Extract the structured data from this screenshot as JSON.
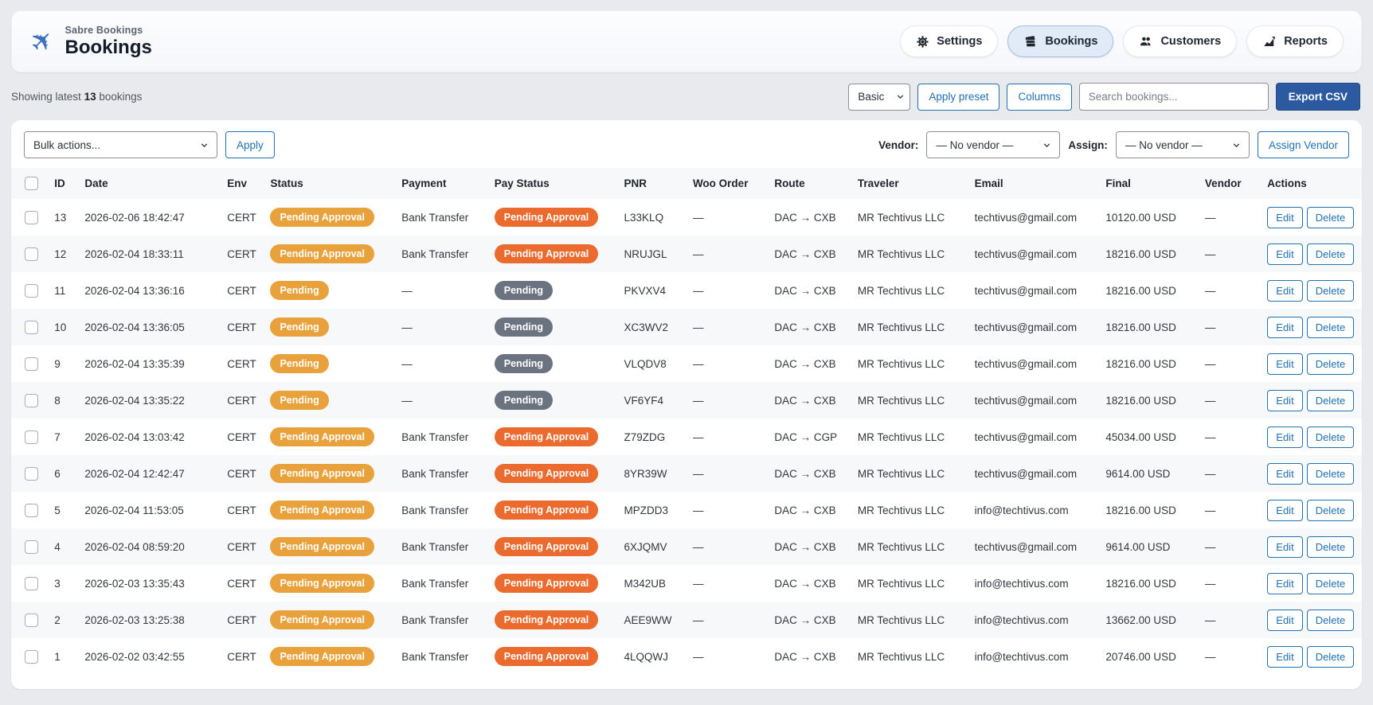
{
  "header": {
    "brand": "Sabre Bookings",
    "title": "Bookings",
    "nav": [
      {
        "label": "Settings",
        "icon": "gear-icon",
        "active": false
      },
      {
        "label": "Bookings",
        "icon": "tickets-icon",
        "active": true
      },
      {
        "label": "Customers",
        "icon": "people-icon",
        "active": false
      },
      {
        "label": "Reports",
        "icon": "chart-icon",
        "active": false
      }
    ]
  },
  "toolbar": {
    "showing_prefix": "Showing latest ",
    "showing_count": "13",
    "showing_suffix": " bookings",
    "preset_select_value": "Basic",
    "apply_preset_label": "Apply preset",
    "columns_label": "Columns",
    "search_placeholder": "Search bookings...",
    "export_label": "Export CSV"
  },
  "bulkbar": {
    "bulk_select_value": "Bulk actions...",
    "apply_label": "Apply",
    "vendor_label": "Vendor:",
    "vendor_select_value": "— No vendor —",
    "assign_label": "Assign:",
    "assign_select_value": "— No vendor —",
    "assign_vendor_label": "Assign Vendor"
  },
  "table": {
    "columns": [
      "ID",
      "Date",
      "Env",
      "Status",
      "Payment",
      "Pay Status",
      "PNR",
      "Woo Order",
      "Route",
      "Traveler",
      "Email",
      "Final",
      "Vendor",
      "Actions"
    ],
    "edit_label": "Edit",
    "delete_label": "Delete",
    "rows": [
      {
        "id": "13",
        "date": "2026-02-06 18:42:47",
        "env": "CERT",
        "status": "Pending Approval",
        "status_type": "amber",
        "payment": "Bank Transfer",
        "pay_status": "Pending Approval",
        "pay_type": "orange",
        "pnr": "L33KLQ",
        "woo_order": "—",
        "route": "DAC → CXB",
        "traveler": "MR Techtivus LLC",
        "email": "techtivus@gmail.com",
        "final": "10120.00 USD",
        "vendor": "—"
      },
      {
        "id": "12",
        "date": "2026-02-04 18:33:11",
        "env": "CERT",
        "status": "Pending Approval",
        "status_type": "amber",
        "payment": "Bank Transfer",
        "pay_status": "Pending Approval",
        "pay_type": "orange",
        "pnr": "NRUJGL",
        "woo_order": "—",
        "route": "DAC → CXB",
        "traveler": "MR Techtivus LLC",
        "email": "techtivus@gmail.com",
        "final": "18216.00 USD",
        "vendor": "—"
      },
      {
        "id": "11",
        "date": "2026-02-04 13:36:16",
        "env": "CERT",
        "status": "Pending",
        "status_type": "amber",
        "payment": "—",
        "pay_status": "Pending",
        "pay_type": "gray",
        "pnr": "PKVXV4",
        "woo_order": "—",
        "route": "DAC → CXB",
        "traveler": "MR Techtivus LLC",
        "email": "techtivus@gmail.com",
        "final": "18216.00 USD",
        "vendor": "—"
      },
      {
        "id": "10",
        "date": "2026-02-04 13:36:05",
        "env": "CERT",
        "status": "Pending",
        "status_type": "amber",
        "payment": "—",
        "pay_status": "Pending",
        "pay_type": "gray",
        "pnr": "XC3WV2",
        "woo_order": "—",
        "route": "DAC → CXB",
        "traveler": "MR Techtivus LLC",
        "email": "techtivus@gmail.com",
        "final": "18216.00 USD",
        "vendor": "—"
      },
      {
        "id": "9",
        "date": "2026-02-04 13:35:39",
        "env": "CERT",
        "status": "Pending",
        "status_type": "amber",
        "payment": "—",
        "pay_status": "Pending",
        "pay_type": "gray",
        "pnr": "VLQDV8",
        "woo_order": "—",
        "route": "DAC → CXB",
        "traveler": "MR Techtivus LLC",
        "email": "techtivus@gmail.com",
        "final": "18216.00 USD",
        "vendor": "—"
      },
      {
        "id": "8",
        "date": "2026-02-04 13:35:22",
        "env": "CERT",
        "status": "Pending",
        "status_type": "amber",
        "payment": "—",
        "pay_status": "Pending",
        "pay_type": "gray",
        "pnr": "VF6YF4",
        "woo_order": "—",
        "route": "DAC → CXB",
        "traveler": "MR Techtivus LLC",
        "email": "techtivus@gmail.com",
        "final": "18216.00 USD",
        "vendor": "—"
      },
      {
        "id": "7",
        "date": "2026-02-04 13:03:42",
        "env": "CERT",
        "status": "Pending Approval",
        "status_type": "amber",
        "payment": "Bank Transfer",
        "pay_status": "Pending Approval",
        "pay_type": "orange",
        "pnr": "Z79ZDG",
        "woo_order": "—",
        "route": "DAC → CGP",
        "traveler": "MR Techtivus LLC",
        "email": "techtivus@gmail.com",
        "final": "45034.00 USD",
        "vendor": "—"
      },
      {
        "id": "6",
        "date": "2026-02-04 12:42:47",
        "env": "CERT",
        "status": "Pending Approval",
        "status_type": "amber",
        "payment": "Bank Transfer",
        "pay_status": "Pending Approval",
        "pay_type": "orange",
        "pnr": "8YR39W",
        "woo_order": "—",
        "route": "DAC → CXB",
        "traveler": "MR Techtivus LLC",
        "email": "techtivus@gmail.com",
        "final": "9614.00 USD",
        "vendor": "—"
      },
      {
        "id": "5",
        "date": "2026-02-04 11:53:05",
        "env": "CERT",
        "status": "Pending Approval",
        "status_type": "amber",
        "payment": "Bank Transfer",
        "pay_status": "Pending Approval",
        "pay_type": "orange",
        "pnr": "MPZDD3",
        "woo_order": "—",
        "route": "DAC → CXB",
        "traveler": "MR Techtivus LLC",
        "email": "info@techtivus.com",
        "final": "18216.00 USD",
        "vendor": "—"
      },
      {
        "id": "4",
        "date": "2026-02-04 08:59:20",
        "env": "CERT",
        "status": "Pending Approval",
        "status_type": "amber",
        "payment": "Bank Transfer",
        "pay_status": "Pending Approval",
        "pay_type": "orange",
        "pnr": "6XJQMV",
        "woo_order": "—",
        "route": "DAC → CXB",
        "traveler": "MR Techtivus LLC",
        "email": "techtivus@gmail.com",
        "final": "9614.00 USD",
        "vendor": "—"
      },
      {
        "id": "3",
        "date": "2026-02-03 13:35:43",
        "env": "CERT",
        "status": "Pending Approval",
        "status_type": "amber",
        "payment": "Bank Transfer",
        "pay_status": "Pending Approval",
        "pay_type": "orange",
        "pnr": "M342UB",
        "woo_order": "—",
        "route": "DAC → CXB",
        "traveler": "MR Techtivus LLC",
        "email": "info@techtivus.com",
        "final": "18216.00 USD",
        "vendor": "—"
      },
      {
        "id": "2",
        "date": "2026-02-03 13:25:38",
        "env": "CERT",
        "status": "Pending Approval",
        "status_type": "amber",
        "payment": "Bank Transfer",
        "pay_status": "Pending Approval",
        "pay_type": "orange",
        "pnr": "AEE9WW",
        "woo_order": "—",
        "route": "DAC → CXB",
        "traveler": "MR Techtivus LLC",
        "email": "info@techtivus.com",
        "final": "13662.00 USD",
        "vendor": "—"
      },
      {
        "id": "1",
        "date": "2026-02-02 03:42:55",
        "env": "CERT",
        "status": "Pending Approval",
        "status_type": "amber",
        "payment": "Bank Transfer",
        "pay_status": "Pending Approval",
        "pay_type": "orange",
        "pnr": "4LQQWJ",
        "woo_order": "—",
        "route": "DAC → CXB",
        "traveler": "MR Techtivus LLC",
        "email": "info@techtivus.com",
        "final": "20746.00 USD",
        "vendor": "—"
      }
    ]
  },
  "colors": {
    "brand_blue": "#3b6fc0",
    "accent_blue": "#2271b1",
    "export_button_blue": "#2c5aa0",
    "badge_amber": "#e9a23b",
    "badge_orange": "#eb6a2e",
    "badge_gray": "#6b7280",
    "nav_active_bg": "#e1eaf7"
  }
}
